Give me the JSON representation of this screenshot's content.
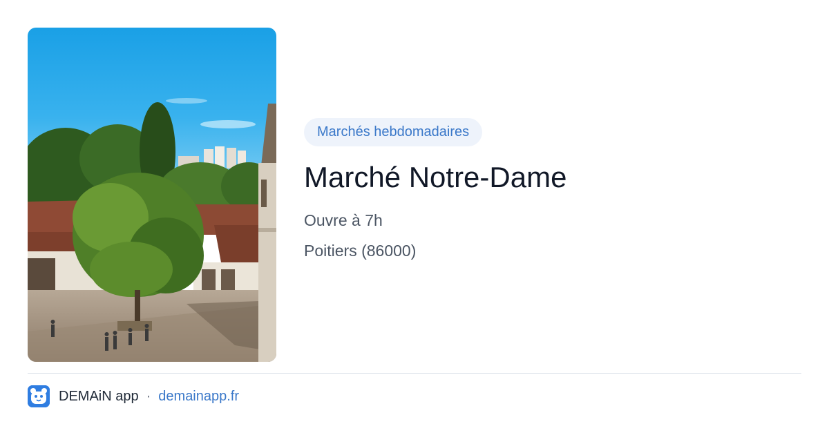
{
  "card": {
    "category": "Marchés hebdomadaires",
    "title": "Marché Notre-Dame",
    "opening": "Ouvre à 7h",
    "location": "Poitiers (86000)"
  },
  "footer": {
    "app_name": "DEMAiN app",
    "separator": "·",
    "site": "demainapp.fr"
  },
  "icons": {
    "app": "paw-lion-icon"
  },
  "colors": {
    "accent": "#3a78c9",
    "badge_bg": "#eef3fb",
    "title": "#111827",
    "meta": "#4b5563",
    "divider": "#d6dee6",
    "app_icon_bg": "#2f7de1"
  }
}
